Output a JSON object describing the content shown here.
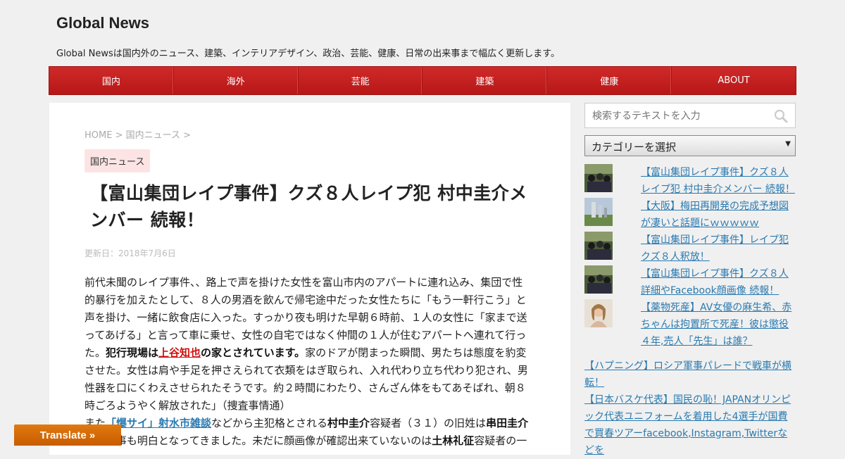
{
  "site": {
    "title": "Global News",
    "description": "Global Newsは国内外のニュース、建築、インテリアデザイン、政治、芸能、健康、日常の出来事まで幅広く更新します。"
  },
  "nav": [
    "国内",
    "海外",
    "芸能",
    "建築",
    "健康",
    "ABOUT"
  ],
  "breadcrumb": {
    "home": "HOME",
    "sep": " > ",
    "category": "国内ニュース",
    "trail": " >"
  },
  "post": {
    "category": "国内ニュース",
    "title": "【富山集団レイプ事件】クズ８人レイプ犯 村中圭介メンバー 続報！",
    "updated": "更新日：2018年7月6日",
    "p1": "前代未聞のレイプ事件、、路上で声を掛けた女性を富山市内のアパートに連れ込み、集団で性的暴行を加えたとして、８人の男酒を飲んで帰宅途中だった女性たちに「もう一軒行こう」と声を掛け、一緒に飲食店に入った。すっかり夜も明けた早朝６時前、１人の女性に「家まで送ってあげる」と言って車に乗せ、女性の自宅ではなく仲間の１人が住むアパートへ連れて行った。",
    "p1_bold_a": "犯行現場は",
    "p1_link": "上谷知也",
    "p1_bold_b": "の家とされています。",
    "p1_rest": "家のドアが閉まった瞬間、男たちは態度を豹変させた。女性は肩や手足を押さえられて衣類をはぎ取られ、入れ代わり立ち代わり犯され、男性器を口にくわえさせられたそうです。約２時間にわたり、さんざん体をもてあそばれ、朝８時ごろようやく解放された」（捜査事情通）",
    "p2_pre": "また",
    "p2_link": "「爆サイ」射水市雑談",
    "p2_mid": "などから主犯格とされる",
    "p2_bold1": "村中圭介",
    "p2_mid2": "容疑者（３１）の旧姓は",
    "p2_bold2": "串田圭介",
    "p2_line2": "である事も明白となってきました。未だに顔画像が確認出来ていないのは",
    "p2_bold3": "土林礼征",
    "p2_line2_end": "容疑者の一"
  },
  "sidebar": {
    "search_placeholder": "検索するテキストを入力",
    "category_select": "カテゴリーを選択",
    "recent": [
      {
        "title": "【富山集団レイプ事件】クズ８人レイプ犯 村中圭介メンバー 続報！",
        "thumb": "group-photo"
      },
      {
        "title": "【大阪】梅田再開発の完成予想図が凄いと話題にｗｗｗｗｗ",
        "thumb": "city-rendering"
      },
      {
        "title": "【富山集団レイプ事件】レイプ犯クズ８人釈放！",
        "thumb": "group-photo"
      },
      {
        "title": "【富山集団レイプ事件】クズ８人詳細やFacebook顔画像 続報！",
        "thumb": "group-photo"
      },
      {
        "title": "【薬物死産】AV女優の麻生希、赤ちゃんは拘置所で死産！彼は懲役４年,売人「先生」は誰？",
        "thumb": "portrait-photo"
      }
    ],
    "more": [
      "【ハプニング】ロシア軍事パレードで戦車が横転！",
      "【日本バスケ代表】国民の恥！JAPANオリンピック代表ユニフォームを着用した4選手が国費で買春ツアーfacebook,Instagram,Twitterなどを"
    ]
  },
  "translate": {
    "label": "Translate »"
  },
  "colors": {
    "nav_red": "#c21f1f",
    "link_blue": "#2a7ab0",
    "badge_pink": "#fde4e4",
    "translate_orange": "#d86a08"
  }
}
